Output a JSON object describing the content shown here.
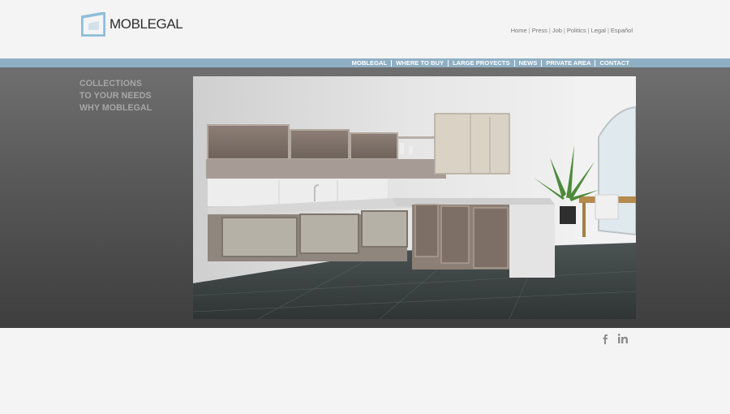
{
  "brand": {
    "name": "MOBLEGAL",
    "logo_color": "#8fbdd8"
  },
  "top_links": [
    {
      "label": "Home"
    },
    {
      "label": "Press"
    },
    {
      "label": "Job"
    },
    {
      "label": "Politics"
    },
    {
      "label": "Legal"
    },
    {
      "label": "Español"
    }
  ],
  "nav": {
    "bar_color": "#8fb0c4",
    "items": [
      {
        "label": "MOBLEGAL"
      },
      {
        "label": "WHERE TO BUY"
      },
      {
        "label": "LARGE PROYECTS"
      },
      {
        "label": "NEWS"
      },
      {
        "label": "PRIVATE AREA"
      },
      {
        "label": "CONTACT"
      }
    ]
  },
  "side_menu": [
    {
      "label": "COLLECTIONS"
    },
    {
      "label": "TO YOUR NEEDS"
    },
    {
      "label": "WHY MOBLEGAL"
    }
  ],
  "hero": {
    "icon": "kitchen-photo"
  },
  "social": [
    {
      "icon": "facebook-icon"
    },
    {
      "icon": "linkedin-icon"
    }
  ]
}
